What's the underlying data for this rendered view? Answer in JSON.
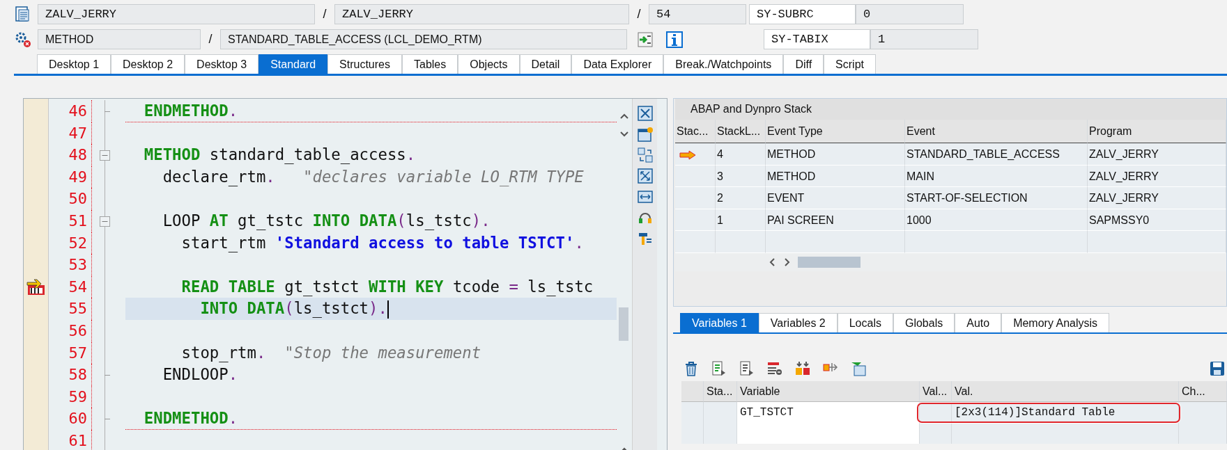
{
  "program_row": {
    "fields": [
      "ZALV_JERRY",
      "ZALV_JERRY",
      "54"
    ],
    "separators": [
      "/",
      "/"
    ]
  },
  "method_row": {
    "fields": [
      "METHOD",
      "STANDARD_TABLE_ACCESS (LCL_DEMO_RTM)"
    ],
    "separators": [
      "/"
    ]
  },
  "system_fields": [
    {
      "name": "SY-SUBRC",
      "value": "0"
    },
    {
      "name": "SY-TABIX",
      "value": "1"
    }
  ],
  "desktop_tabs": [
    {
      "label": "Desktop 1",
      "selected": false
    },
    {
      "label": "Desktop 2",
      "selected": false
    },
    {
      "label": "Desktop 3",
      "selected": false
    },
    {
      "label": "Standard",
      "selected": true
    },
    {
      "label": "Structures",
      "selected": false
    },
    {
      "label": "Tables",
      "selected": false
    },
    {
      "label": "Objects",
      "selected": false
    },
    {
      "label": "Detail",
      "selected": false
    },
    {
      "label": "Data Explorer",
      "selected": false
    },
    {
      "label": "Break./Watchpoints",
      "selected": false
    },
    {
      "label": "Diff",
      "selected": false
    },
    {
      "label": "Script",
      "selected": false
    }
  ],
  "code": {
    "lines": [
      {
        "number": "46",
        "expanded": false,
        "block_end": true,
        "separator": true,
        "current": false,
        "cursor": false,
        "tokens": [
          {
            "kind": "keyword",
            "text": "  ENDMETHOD"
          },
          {
            "kind": "op",
            "text": "."
          }
        ]
      },
      {
        "number": "47",
        "expanded": false,
        "block_end": false,
        "separator": false,
        "current": false,
        "cursor": false
      },
      {
        "number": "48",
        "expanded": true,
        "block_end": false,
        "separator": false,
        "current": false,
        "cursor": false,
        "tokens": [
          {
            "kind": "keyword",
            "text": "  METHOD"
          },
          {
            "kind": "text",
            "text": " standard_table_access"
          },
          {
            "kind": "op",
            "text": "."
          }
        ]
      },
      {
        "number": "49",
        "expanded": false,
        "block_end": false,
        "separator": false,
        "current": false,
        "cursor": false,
        "tokens": [
          {
            "kind": "text",
            "text": "    declare_rtm"
          },
          {
            "kind": "op",
            "text": "."
          },
          {
            "kind": "comment",
            "text": "   \"declares variable LO_RTM TYPE"
          }
        ]
      },
      {
        "number": "50",
        "expanded": false,
        "block_end": false,
        "separator": false,
        "current": false,
        "cursor": false
      },
      {
        "number": "51",
        "expanded": true,
        "block_end": false,
        "separator": false,
        "current": false,
        "cursor": false,
        "tokens": [
          {
            "kind": "text",
            "text": "    LOOP"
          },
          {
            "kind": "keyword",
            "text": " AT"
          },
          {
            "kind": "text",
            "text": " gt_tstc"
          },
          {
            "kind": "keyword",
            "text": " INTO DATA"
          },
          {
            "kind": "op",
            "text": "("
          },
          {
            "kind": "text",
            "text": "ls_tstc"
          },
          {
            "kind": "op",
            "text": ")."
          }
        ]
      },
      {
        "number": "52",
        "expanded": false,
        "block_end": false,
        "separator": false,
        "current": false,
        "cursor": false,
        "tokens": [
          {
            "kind": "text",
            "text": "      start_rtm "
          },
          {
            "kind": "string",
            "text": "'Standard access to table TSTCT'"
          },
          {
            "kind": "op",
            "text": "."
          }
        ]
      },
      {
        "number": "53",
        "expanded": false,
        "block_end": false,
        "separator": false,
        "current": false,
        "cursor": false
      },
      {
        "number": "54",
        "expanded": false,
        "block_end": false,
        "separator": false,
        "current": true,
        "cursor": false,
        "tokens": [
          {
            "kind": "keyword",
            "text": "      READ TABLE"
          },
          {
            "kind": "text",
            "text": " gt_tstct"
          },
          {
            "kind": "keyword",
            "text": " WITH KEY"
          },
          {
            "kind": "text",
            "text": " tcode "
          },
          {
            "kind": "op",
            "text": "="
          },
          {
            "kind": "text",
            "text": " ls_tstc"
          }
        ]
      },
      {
        "number": "55",
        "expanded": false,
        "block_end": false,
        "separator": false,
        "current": false,
        "cursor": true,
        "tokens": [
          {
            "kind": "keyword",
            "text": "        INTO DATA"
          },
          {
            "kind": "op",
            "text": "("
          },
          {
            "kind": "text",
            "text": "ls_tstct"
          },
          {
            "kind": "op",
            "text": ")."
          }
        ]
      },
      {
        "number": "56",
        "expanded": false,
        "block_end": false,
        "separator": false,
        "current": false,
        "cursor": false
      },
      {
        "number": "57",
        "expanded": false,
        "block_end": false,
        "separator": false,
        "current": false,
        "cursor": false,
        "tokens": [
          {
            "kind": "text",
            "text": "      stop_rtm"
          },
          {
            "kind": "op",
            "text": "."
          },
          {
            "kind": "comment",
            "text": "  \"Stop the measurement"
          }
        ]
      },
      {
        "number": "58",
        "expanded": false,
        "block_end": true,
        "separator": false,
        "current": false,
        "cursor": false,
        "tokens": [
          {
            "kind": "text",
            "text": "    ENDLOOP"
          },
          {
            "kind": "op",
            "text": "."
          }
        ]
      },
      {
        "number": "59",
        "expanded": false,
        "block_end": false,
        "separator": false,
        "current": false,
        "cursor": false
      },
      {
        "number": "60",
        "expanded": false,
        "block_end": true,
        "separator": true,
        "current": false,
        "cursor": false,
        "tokens": [
          {
            "kind": "keyword",
            "text": "  ENDMETHOD"
          },
          {
            "kind": "op",
            "text": "."
          }
        ]
      },
      {
        "number": "61",
        "expanded": false,
        "block_end": false,
        "separator": false,
        "current": false,
        "cursor": false
      }
    ]
  },
  "stack": {
    "title": "ABAP and Dynpro Stack",
    "columns": [
      "Stac...",
      "StackL...",
      "Event Type",
      "Event",
      "Program"
    ],
    "rows": [
      {
        "current": true,
        "cells": [
          "",
          "4",
          "METHOD",
          "STANDARD_TABLE_ACCESS",
          "ZALV_JERRY"
        ]
      },
      {
        "current": false,
        "cells": [
          "",
          "3",
          "METHOD",
          "MAIN",
          "ZALV_JERRY"
        ]
      },
      {
        "current": false,
        "cells": [
          "",
          "2",
          "EVENT",
          "START-OF-SELECTION",
          "ZALV_JERRY"
        ]
      },
      {
        "current": false,
        "cells": [
          "",
          "1",
          "PAI SCREEN",
          "1000",
          "SAPMSSY0"
        ]
      }
    ]
  },
  "variable_tabs": [
    {
      "label": "Variables 1",
      "selected": true
    },
    {
      "label": "Variables 2",
      "selected": false
    },
    {
      "label": "Locals",
      "selected": false
    },
    {
      "label": "Globals",
      "selected": false
    },
    {
      "label": "Auto",
      "selected": false
    },
    {
      "label": "Memory Analysis",
      "selected": false
    }
  ],
  "variables": {
    "columns": [
      "Sta...",
      "Variable",
      "Val...",
      "Val.",
      "Ch..."
    ],
    "rows": [
      {
        "variable": "GT_TSTCT",
        "value": "[2x3(114)]Standard Table",
        "highlighted": true
      }
    ]
  }
}
